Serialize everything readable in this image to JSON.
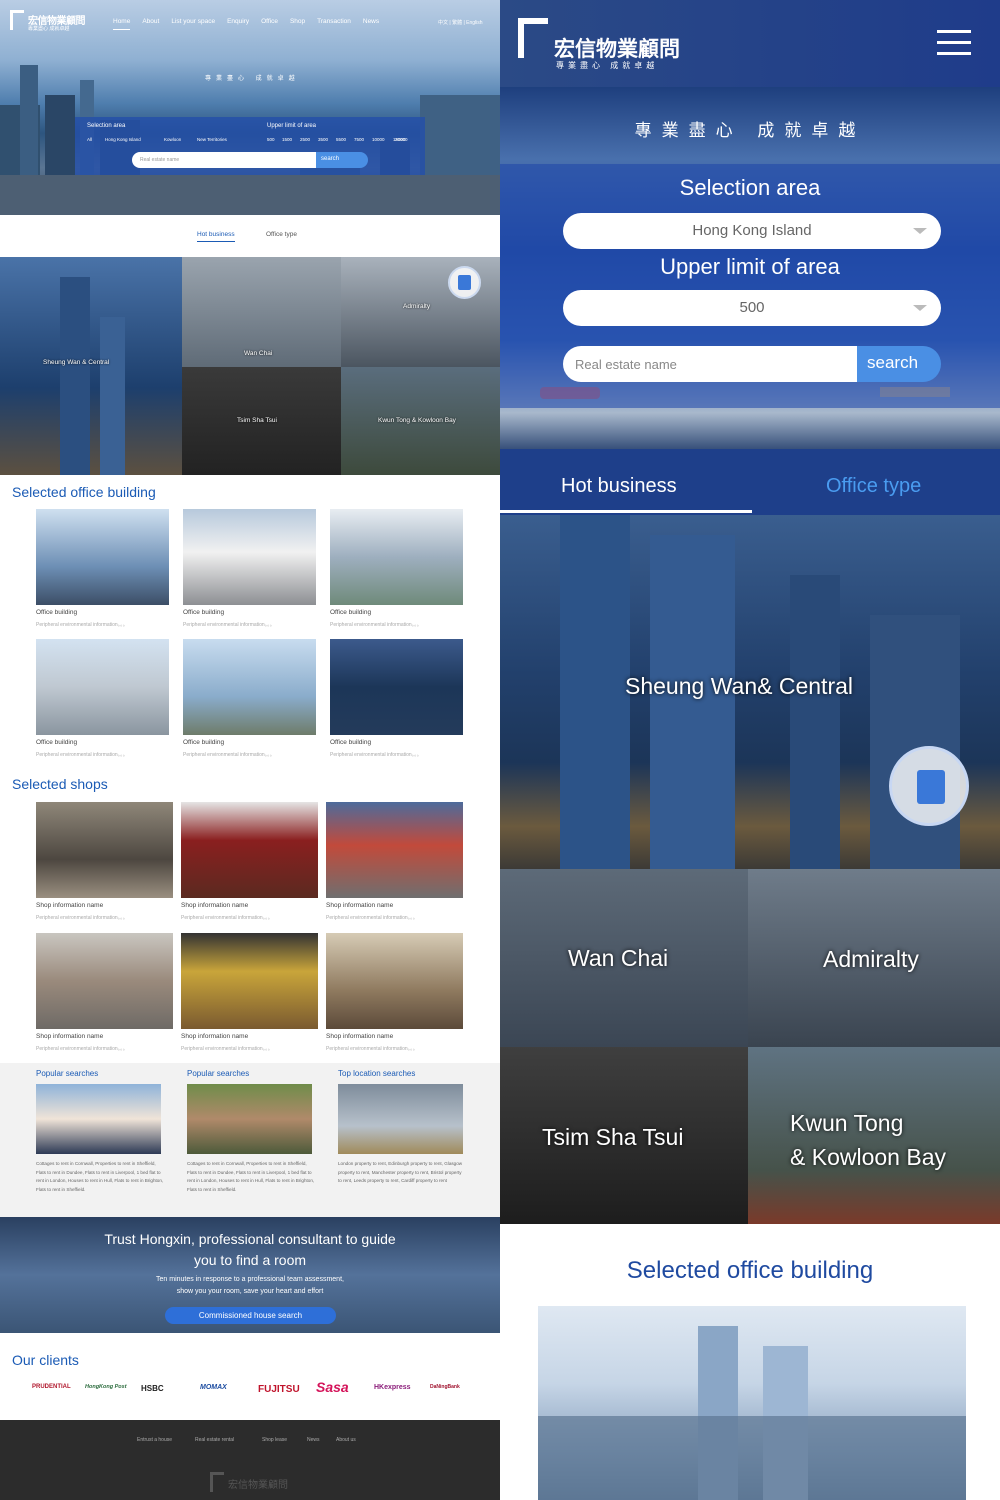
{
  "desktop": {
    "logo": {
      "title": "宏信物業顧問",
      "subtitle": "專業盡心 成就卓越"
    },
    "nav": [
      {
        "label": "Home",
        "active": true
      },
      {
        "label": "About"
      },
      {
        "label": "List your space"
      },
      {
        "label": "Enquiry"
      },
      {
        "label": "Office"
      },
      {
        "label": "Shop"
      },
      {
        "label": "Transaction"
      },
      {
        "label": "News"
      }
    ],
    "lang": "中文 | 繁體 | English",
    "slogan": "專業盡心 成就卓越",
    "search": {
      "selection_label": "Selection area",
      "areas": [
        "All",
        "Hong Kong Island",
        "Kowloon",
        "New Territories"
      ],
      "upper_label": "Upper limit of area",
      "limits": [
        "500",
        "1500",
        "2500",
        "3500",
        "5500",
        "7500",
        "10000",
        "15000",
        "20000"
      ],
      "placeholder": "Real estate name",
      "button": "search"
    },
    "tabs": {
      "hot": "Hot business",
      "office": "Office type"
    },
    "districts": {
      "sheung_wan": "Sheung Wan & Central",
      "wan_chai": "Wan Chai",
      "admiralty": "Admiralty",
      "tsim_sha_tsui": "Tsim Sha Tsui",
      "kwun_tong": "Kwun Tong & Kowloon Bay"
    },
    "offices_title": "Selected office building",
    "offices": [
      {
        "title": "Office building",
        "sub": "Peripheral environmental information。。。"
      },
      {
        "title": "Office building",
        "sub": "Peripheral environmental information。。。"
      },
      {
        "title": "Office building",
        "sub": "Peripheral environmental information。。。"
      },
      {
        "title": "Office building",
        "sub": "Peripheral environmental information。。。"
      },
      {
        "title": "Office building",
        "sub": "Peripheral environmental information。。。"
      },
      {
        "title": "Office building",
        "sub": "Peripheral environmental information。。。"
      }
    ],
    "shops_title": "Selected shops",
    "shops": [
      {
        "title": "Shop information name",
        "sub": "Peripheral environmental information。。。"
      },
      {
        "title": "Shop information name",
        "sub": "Peripheral environmental information。。。"
      },
      {
        "title": "Shop information name",
        "sub": "Peripheral environmental information。。。"
      },
      {
        "title": "Shop information name",
        "sub": "Peripheral environmental information。。。"
      },
      {
        "title": "Shop information name",
        "sub": "Peripheral environmental information。。。"
      },
      {
        "title": "Shop information name",
        "sub": "Peripheral environmental information。。。"
      }
    ],
    "popular": [
      {
        "title": "Popular searches",
        "text": "Cottages to rent in Cornwall, Properties to rent in Sheffield, Flats to rent in Dundee, Flats to rent in Liverpool, 1 bed flat to rent in London, Houses to rent in Hull, Flats to rent in Brighton, Flats to rent in Sheffield."
      },
      {
        "title": "Popular searches",
        "text": "Cottages to rent in Cornwall, Properties to rent in Sheffield, Flats to rent in Dundee, Flats to rent in Liverpool, 1 bed flat to rent in London, Houses to rent in Hull, Flats to rent in Brighton, Flats to rent in Sheffield."
      },
      {
        "title": "Top location searches",
        "text": "London property to rent, Edinburgh property to rent, Glasgow property to rent, Manchester property to rent, Bristol property to rent, Leeds property to rent, Cardiff property to rent"
      }
    ],
    "trust": {
      "line1": "Trust Hongxin, professional consultant to guide",
      "line2": "you to find a room",
      "sub1": "Ten minutes in response to a professional team assessment,",
      "sub2": "show you your room, save your heart and effort",
      "button": "Commissioned house search"
    },
    "clients_title": "Our clients",
    "clients": [
      "PRUDENTIAL",
      "HongKong Post",
      "HSBC",
      "MOMAX",
      "FUJITSU",
      "Sasa",
      "HKexpress",
      "DaNingBank"
    ],
    "footer": [
      "Entrust a house",
      "Real estate rental",
      "Shop lease",
      "News",
      "About us"
    ]
  },
  "mobile": {
    "logo": {
      "title": "宏信物業顧問",
      "subtitle": "專業盡心 成就卓越"
    },
    "slogan": "專業盡心  成就卓越",
    "selection_label": "Selection area",
    "selection_value": "Hong Kong Island",
    "upper_label": "Upper limit of area",
    "upper_value": "500",
    "placeholder": "Real estate name",
    "button": "search",
    "tabs": {
      "hot": "Hot business",
      "office": "Office type"
    },
    "districts": {
      "sheung_wan": "Sheung Wan& Central",
      "wan_chai": "Wan Chai",
      "admiralty": "Admiralty",
      "tsim_sha_tsui": "Tsim Sha Tsui",
      "kwun_tong_1": "Kwun Tong",
      "kwun_tong_2": "& Kowloon Bay"
    },
    "section_title": "Selected office building"
  },
  "colors": {
    "brand_blue": "#1f3c8a",
    "accent": "#4a8fe4",
    "link": "#1b5bb5"
  }
}
